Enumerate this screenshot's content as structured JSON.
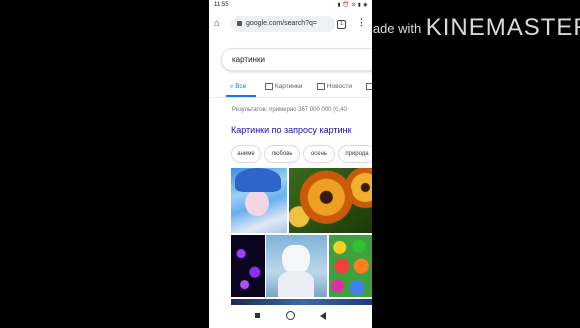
{
  "status": {
    "time": "11:55",
    "icons": "▮ ⏰ ⊙ ▮ ◉"
  },
  "browser": {
    "url": "google.com/search?q=",
    "tabs_count": "1"
  },
  "search": {
    "query": "картинки"
  },
  "tabs": [
    "Все",
    "Картинки",
    "Новости"
  ],
  "results": {
    "count_text": "Результатов: примерно 367 000 000 (0,40"
  },
  "images_section": {
    "heading": "Картинки по запросу картинк",
    "chips": [
      "аниме",
      "любовь",
      "осень",
      "природа"
    ]
  },
  "watermark": {
    "prefix": "Made with",
    "brand": "KINEMASTER"
  },
  "colors": {
    "link_blue": "#1a0dab",
    "accent_blue": "#1a73e8"
  }
}
